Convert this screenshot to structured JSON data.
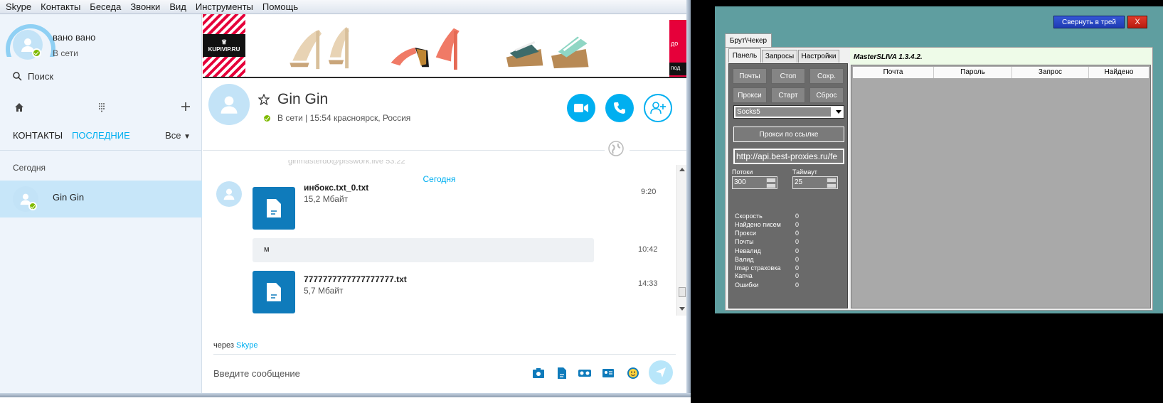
{
  "skype": {
    "menu": [
      "Skype",
      "Контакты",
      "Беседа",
      "Звонки",
      "Вид",
      "Инструменты",
      "Помощь"
    ],
    "profile": {
      "name": "вано вано",
      "status": "В сети"
    },
    "search_label": "Поиск",
    "tabs": {
      "contacts": "КОНТАКТЫ",
      "recent": "ПОСЛЕДНИЕ",
      "filter": "Все"
    },
    "today_label": "Сегодня",
    "contact": {
      "name": "Gin Gin"
    },
    "banner": {
      "logo": "KUPIVIP.RU",
      "promo_top": "до",
      "promo_bottom": "под"
    },
    "conversation": {
      "name": "Gin Gin",
      "status": "В сети | 15:54 красноярск, Россия",
      "faded_text": "ginmasterdo@pisswork.live 53:22",
      "today_separator": "Сегодня",
      "messages": [
        {
          "type": "file",
          "name": "инбокс.txt_0.txt",
          "size": "15,2 Мбайт",
          "time": "9:20"
        },
        {
          "type": "text",
          "text": "м",
          "time": "10:42"
        },
        {
          "type": "file",
          "name": "7777777777777777777.txt",
          "size": "5,7 Мбайт",
          "time": "14:33"
        }
      ],
      "via_prefix": "через",
      "via_link": "Skype",
      "composer_placeholder": "Введите сообщение"
    },
    "colors": {
      "accent": "#00aff0",
      "presence": "#7fba00",
      "file_tile": "#0f7bbb"
    }
  },
  "masterpanel": {
    "collapse_button": "Свернуть в трей",
    "close_button": "X",
    "outer_tab": "Брут\\Чекер",
    "inner_tabs": [
      "Панель",
      "Запросы",
      "Настройки"
    ],
    "version": "MasterSLIVA 1.3.4.2.",
    "buttons": [
      "Почты",
      "Стоп",
      "Сохр.",
      "Прокси",
      "Старт",
      "Сброс"
    ],
    "proxy_type": "Socks5",
    "proxy_url_button": "Прокси по ссылке",
    "proxy_url": "http://api.best-proxies.ru/fe",
    "threads_label": "Потоки",
    "threads_value": "300",
    "timeout_label": "Таймаут",
    "timeout_value": "25",
    "stats": [
      {
        "label": "Скорость",
        "value": "0"
      },
      {
        "label": "Найдено писем",
        "value": "0"
      },
      {
        "label": "Прокси",
        "value": "0"
      },
      {
        "label": "Почты",
        "value": "0"
      },
      {
        "label": "Невалид",
        "value": "0"
      },
      {
        "label": "Валид",
        "value": "0"
      },
      {
        "label": "Imap страховка",
        "value": "0"
      },
      {
        "label": "Капча",
        "value": "0"
      },
      {
        "label": "Ошибки",
        "value": "0"
      }
    ],
    "grid_columns": [
      "Почта",
      "Пароль",
      "Запрос",
      "Найдено"
    ]
  }
}
